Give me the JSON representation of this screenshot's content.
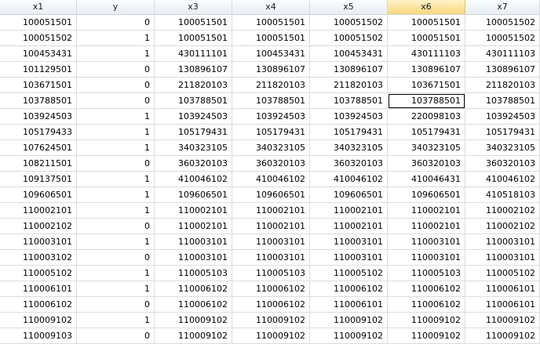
{
  "columns": [
    "x1",
    "y",
    "x3",
    "x4",
    "x5",
    "x6",
    "x7"
  ],
  "active_column": "x6",
  "selected_cell": {
    "row": 5,
    "col": 5
  },
  "colors": {
    "active_header": "#f7d77e",
    "grid_line": "#dcdcdc",
    "header_bg": "#e9eef4"
  },
  "rows": [
    [
      "100051501",
      "0",
      "100051501",
      "100051501",
      "100051502",
      "100051501",
      "100051502"
    ],
    [
      "100051502",
      "1",
      "100051501",
      "100051501",
      "100051502",
      "100051501",
      "100051502"
    ],
    [
      "100453431",
      "1",
      "430111101",
      "100453431",
      "100453431",
      "430111103",
      "430111103"
    ],
    [
      "101129501",
      "0",
      "130896107",
      "130896107",
      "130896107",
      "130896107",
      "130896107"
    ],
    [
      "103671501",
      "0",
      "211820103",
      "211820103",
      "211820103",
      "103671501",
      "211820103"
    ],
    [
      "103788501",
      "0",
      "103788501",
      "103788501",
      "103788501",
      "103788501",
      "103788501"
    ],
    [
      "103924503",
      "1",
      "103924503",
      "103924503",
      "103924503",
      "220098103",
      "103924503"
    ],
    [
      "105179433",
      "1",
      "105179431",
      "105179431",
      "105179431",
      "105179431",
      "105179431"
    ],
    [
      "107624501",
      "1",
      "340323105",
      "340323105",
      "340323105",
      "340323105",
      "340323105"
    ],
    [
      "108211501",
      "0",
      "360320103",
      "360320103",
      "360320103",
      "360320103",
      "360320103"
    ],
    [
      "109137501",
      "1",
      "410046102",
      "410046102",
      "410046102",
      "410046431",
      "410046102"
    ],
    [
      "109606501",
      "1",
      "109606501",
      "109606501",
      "109606501",
      "109606501",
      "410518103"
    ],
    [
      "110002101",
      "1",
      "110002101",
      "110002101",
      "110002101",
      "110002101",
      "110002102"
    ],
    [
      "110002102",
      "0",
      "110002101",
      "110002101",
      "110002101",
      "110002101",
      "110002102"
    ],
    [
      "110003101",
      "1",
      "110003101",
      "110003101",
      "110003101",
      "110003101",
      "110003101"
    ],
    [
      "110003102",
      "0",
      "110003101",
      "110003101",
      "110003101",
      "110003101",
      "110003101"
    ],
    [
      "110005102",
      "1",
      "110005103",
      "110005103",
      "110005102",
      "110005103",
      "110005102"
    ],
    [
      "110006101",
      "1",
      "110006102",
      "110006102",
      "110006102",
      "110006102",
      "110006101"
    ],
    [
      "110006102",
      "0",
      "110006102",
      "110006102",
      "110006101",
      "110006102",
      "110006101"
    ],
    [
      "110009102",
      "1",
      "110009102",
      "110009102",
      "110009102",
      "110009102",
      "110009102"
    ],
    [
      "110009103",
      "0",
      "110009102",
      "110009102",
      "110009102",
      "110009102",
      "110009102"
    ]
  ]
}
